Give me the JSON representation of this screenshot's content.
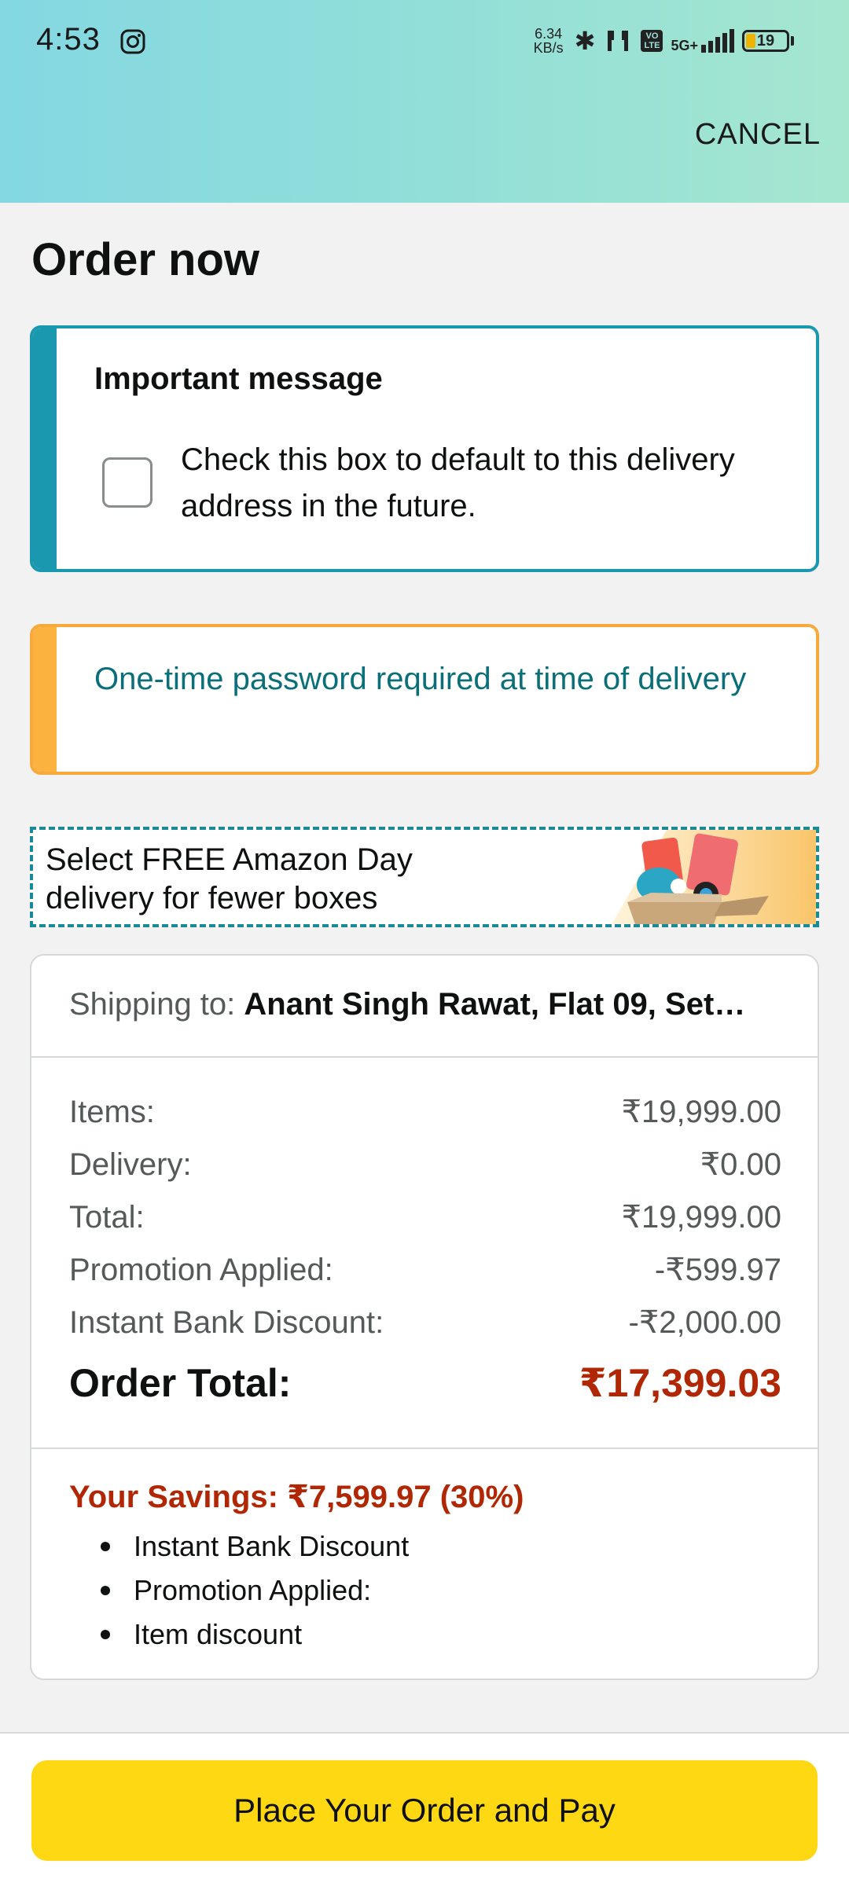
{
  "status_bar": {
    "time": "4:53",
    "net_speed_value": "6.34",
    "net_speed_unit": "KB/s",
    "volte_label": "VO LTE",
    "network": "5G+",
    "battery": "19"
  },
  "header": {
    "cancel_label": "CANCEL"
  },
  "page": {
    "title": "Order now"
  },
  "important_message": {
    "heading": "Important message",
    "checkbox_checked": false,
    "checkbox_text": "Check this box to default to this delivery address in the future."
  },
  "otp_notice": {
    "text": "One-time password required at time of delivery"
  },
  "amazon_day": {
    "line1": "Select FREE Amazon Day",
    "line2": "delivery for fewer boxes"
  },
  "summary": {
    "shipping_label": "Shipping to:",
    "shipping_value": "Anant Singh Rawat, Flat 09, Set…",
    "lines": [
      {
        "label": "Items:",
        "value": "₹19,999.00"
      },
      {
        "label": "Delivery:",
        "value": "₹0.00"
      },
      {
        "label": "Total:",
        "value": "₹19,999.00"
      },
      {
        "label": "Promotion Applied:",
        "value": "-₹599.97"
      },
      {
        "label": "Instant Bank Discount:",
        "value": "-₹2,000.00"
      }
    ],
    "order_total_label": "Order Total:",
    "order_total_value": "₹17,399.03",
    "savings_text": "Your Savings: ₹7,599.97 (30%)",
    "savings_items": [
      "Instant Bank Discount",
      "Promotion Applied:",
      "Item discount"
    ]
  },
  "footer": {
    "place_order_label": "Place Your Order and Pay"
  },
  "colors": {
    "accent_teal": "#1a98b0",
    "accent_orange": "#fcb23f",
    "price_red": "#b12704",
    "button_yellow": "#ffd814"
  }
}
